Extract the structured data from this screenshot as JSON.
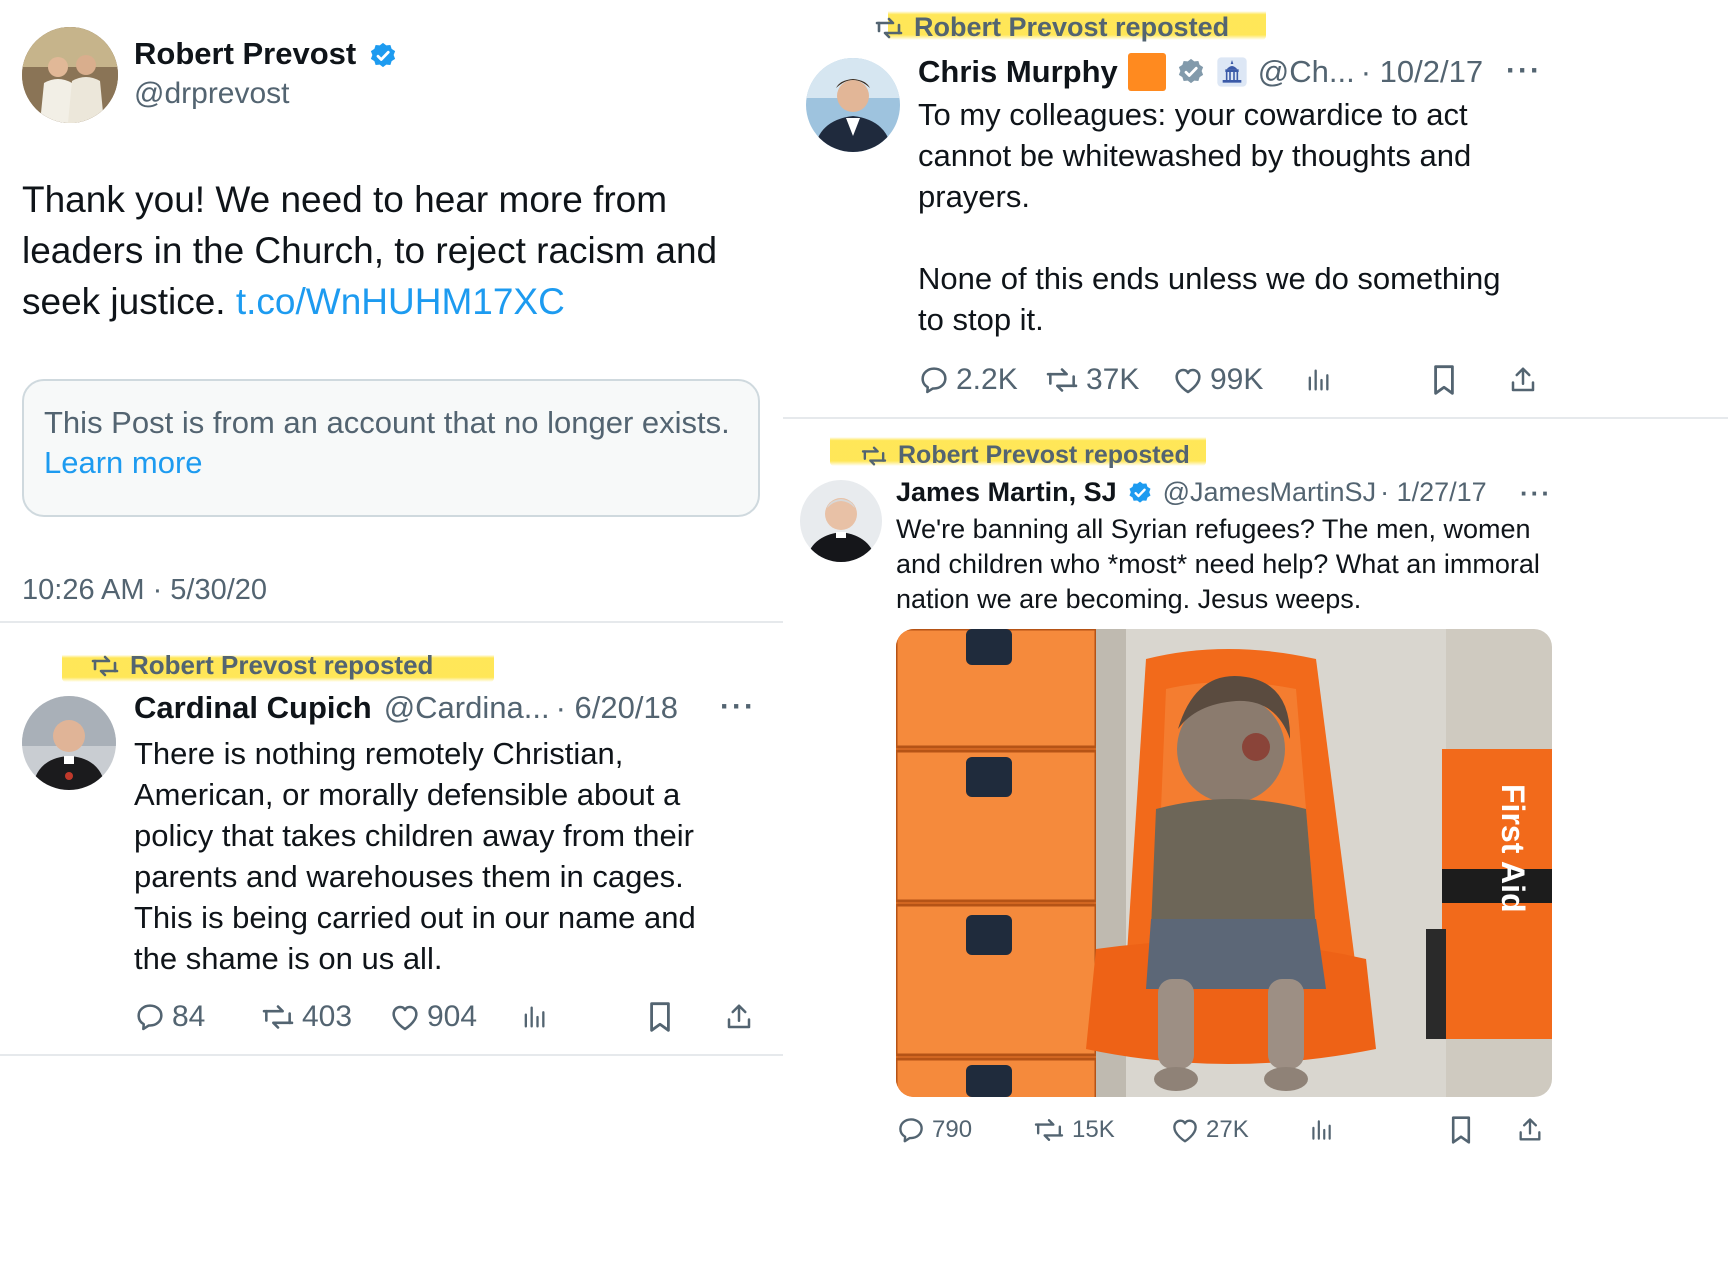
{
  "main_tweet": {
    "author_name": "Robert Prevost",
    "author_handle": "@drprevost",
    "text": "Thank you! We need to hear more from leaders in the Church, to reject racism and seek justice.",
    "link": "t.co/WnHUHM17XC",
    "notice_text": "This Post is from an account that no longer exists.",
    "notice_link": "Learn more",
    "timestamp": "10:26 AM · 5/30/20"
  },
  "cupich_repost": {
    "repost_label": "Robert Prevost reposted",
    "author_name": "Cardinal Cupich",
    "author_handle": "@Cardina...",
    "date": "· 6/20/18",
    "text_lines": [
      "There is nothing remotely Christian,",
      "American, or morally defensible about a",
      "policy that takes children away from their",
      "parents and warehouses them in cages.",
      "This is being carried out in our name and",
      "the shame is on us all."
    ],
    "replies": "84",
    "reposts": "403",
    "likes": "904",
    "more": "···"
  },
  "murphy_repost": {
    "repost_label": "Robert Prevost reposted",
    "author_name": "Chris Murphy",
    "author_handle": "@Ch...",
    "date": "· 10/2/17",
    "text_lines": [
      "To my colleagues: your cowardice to act",
      "cannot be whitewashed by thoughts and",
      "prayers."
    ],
    "text_lines_2": [
      "None of this ends unless we do something",
      "to stop it."
    ],
    "replies": "2.2K",
    "reposts": "37K",
    "likes": "99K",
    "more": "···",
    "flag_color": "#ff8a1f"
  },
  "martin_repost": {
    "repost_label": "Robert Prevost reposted",
    "author_name": "James Martin, SJ",
    "author_handle": "@JamesMartinSJ",
    "date": "· 1/27/17",
    "text_lines": [
      "We're banning all Syrian refugees? The men, women",
      "and children who *most* need help? What an immoral",
      "nation we are becoming. Jesus weeps."
    ],
    "image_box_label": "First Aid",
    "replies": "790",
    "reposts": "15K",
    "likes": "27K",
    "more": "···"
  },
  "colors": {
    "accent": "#1d9bf0",
    "highlight": "#ffe446",
    "muted": "#536471",
    "divider": "#e6e9ec",
    "ambulance_orange": "#f26a1b"
  }
}
